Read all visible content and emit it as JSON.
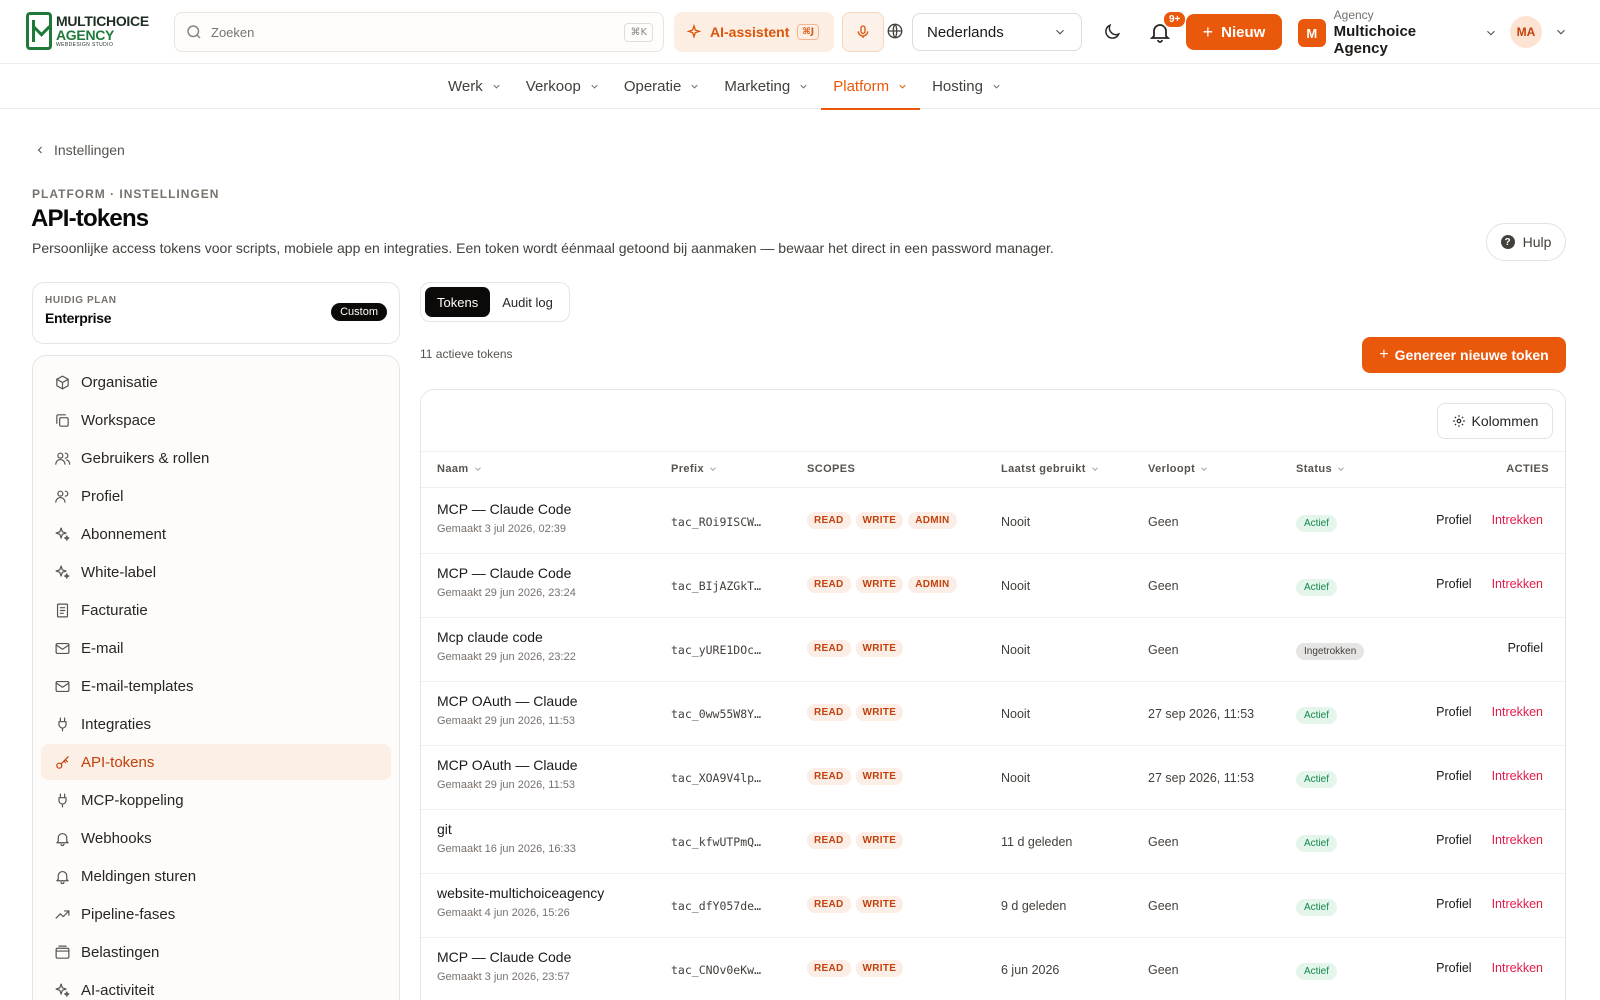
{
  "brand": {
    "line1": "MULTICHOICE",
    "line2": "AGENCY",
    "line3": "WEBDESIGN STUDIO"
  },
  "search": {
    "placeholder": "Zoeken",
    "shortcut": "⌘K"
  },
  "ai": {
    "label": "AI-assistent",
    "shortcut": "⌘J"
  },
  "language": {
    "selected": "Nederlands"
  },
  "notifications": {
    "count": "9+"
  },
  "new_button": "Nieuw",
  "agency": {
    "initial": "M",
    "label": "Agency",
    "name": "Multichoice Agency"
  },
  "user": {
    "initials": "MA"
  },
  "nav": [
    {
      "label": "Werk"
    },
    {
      "label": "Verkoop"
    },
    {
      "label": "Operatie"
    },
    {
      "label": "Marketing"
    },
    {
      "label": "Platform",
      "active": true
    },
    {
      "label": "Hosting"
    }
  ],
  "breadcrumb": "Instellingen",
  "eyebrow": "PLATFORM · INSTELLINGEN",
  "title": "API-tokens",
  "description": "Persoonlijke access tokens voor scripts, mobiele app en integraties. Een token wordt éénmaal getoond bij aanmaken — bewaar het direct in een password manager.",
  "help_label": "Hulp",
  "plan": {
    "label": "HUIDIG PLAN",
    "name": "Enterprise",
    "badge": "Custom"
  },
  "sidebar": [
    {
      "label": "Organisatie",
      "icon": "cube-icon"
    },
    {
      "label": "Workspace",
      "icon": "copy-icon"
    },
    {
      "label": "Gebruikers & rollen",
      "icon": "users-icon"
    },
    {
      "label": "Profiel",
      "icon": "user-icon"
    },
    {
      "label": "Abonnement",
      "icon": "sparkle-icon"
    },
    {
      "label": "White-label",
      "icon": "sparkle-icon"
    },
    {
      "label": "Facturatie",
      "icon": "receipt-icon"
    },
    {
      "label": "E-mail",
      "icon": "mail-icon"
    },
    {
      "label": "E-mail-templates",
      "icon": "mail-icon"
    },
    {
      "label": "Integraties",
      "icon": "plug-icon"
    },
    {
      "label": "API-tokens",
      "icon": "key-icon",
      "active": true
    },
    {
      "label": "MCP-koppeling",
      "icon": "plug-icon"
    },
    {
      "label": "Webhooks",
      "icon": "bell-icon"
    },
    {
      "label": "Meldingen sturen",
      "icon": "bell-icon"
    },
    {
      "label": "Pipeline-fases",
      "icon": "trend-icon"
    },
    {
      "label": "Belastingen",
      "icon": "wallet-icon"
    },
    {
      "label": "AI-activiteit",
      "icon": "sparkle-icon"
    }
  ],
  "tabs": [
    {
      "label": "Tokens",
      "active": true
    },
    {
      "label": "Audit log"
    }
  ],
  "count_label": "11 actieve tokens",
  "generate_label": "Genereer nieuwe token",
  "columns_label": "Kolommen",
  "columns": {
    "name": "Naam",
    "prefix": "Prefix",
    "scopes": "SCOPES",
    "last": "Laatst gebruikt",
    "expires": "Verloopt",
    "status": "Status",
    "actions": "ACTIES"
  },
  "tokens": [
    {
      "name": "MCP — Claude Code",
      "created": "Gemaakt 3 jul 2026, 02:39",
      "prefix": "tac_ROi9ISCW…",
      "scopes": [
        "READ",
        "WRITE",
        "ADMIN"
      ],
      "last": "Nooit",
      "expires": "Geen",
      "status": "Actief",
      "profile": "Profiel",
      "revoke": "Intrekken"
    },
    {
      "name": "MCP — Claude Code",
      "created": "Gemaakt 29 jun 2026, 23:24",
      "prefix": "tac_BIjAZGkT…",
      "scopes": [
        "READ",
        "WRITE",
        "ADMIN"
      ],
      "last": "Nooit",
      "expires": "Geen",
      "status": "Actief",
      "profile": "Profiel",
      "revoke": "Intrekken"
    },
    {
      "name": "Mcp claude code",
      "created": "Gemaakt 29 jun 2026, 23:22",
      "prefix": "tac_yURE1DOc…",
      "scopes": [
        "READ",
        "WRITE"
      ],
      "last": "Nooit",
      "expires": "Geen",
      "status": "Ingetrokken",
      "profile": "Profiel",
      "revoke": ""
    },
    {
      "name": "MCP OAuth — Claude",
      "created": "Gemaakt 29 jun 2026, 11:53",
      "prefix": "tac_0ww55W8Y…",
      "scopes": [
        "READ",
        "WRITE"
      ],
      "last": "Nooit",
      "expires": "27 sep 2026, 11:53",
      "status": "Actief",
      "profile": "Profiel",
      "revoke": "Intrekken"
    },
    {
      "name": "MCP OAuth — Claude",
      "created": "Gemaakt 29 jun 2026, 11:53",
      "prefix": "tac_XOA9V4lp…",
      "scopes": [
        "READ",
        "WRITE"
      ],
      "last": "Nooit",
      "expires": "27 sep 2026, 11:53",
      "status": "Actief",
      "profile": "Profiel",
      "revoke": "Intrekken"
    },
    {
      "name": "git",
      "created": "Gemaakt 16 jun 2026, 16:33",
      "prefix": "tac_kfwUTPmQ…",
      "scopes": [
        "READ",
        "WRITE"
      ],
      "last": "11 d geleden",
      "expires": "Geen",
      "status": "Actief",
      "profile": "Profiel",
      "revoke": "Intrekken"
    },
    {
      "name": "website-multichoiceagency",
      "created": "Gemaakt 4 jun 2026, 15:26",
      "prefix": "tac_dfY057de…",
      "scopes": [
        "READ",
        "WRITE"
      ],
      "last": "9 d geleden",
      "expires": "Geen",
      "status": "Actief",
      "profile": "Profiel",
      "revoke": "Intrekken"
    },
    {
      "name": "MCP — Claude Code",
      "created": "Gemaakt 3 jun 2026, 23:57",
      "prefix": "tac_CNOv0eKw…",
      "scopes": [
        "READ",
        "WRITE"
      ],
      "last": "6 jun 2026",
      "expires": "Geen",
      "status": "Actief",
      "profile": "Profiel",
      "revoke": "Intrekken"
    }
  ],
  "colors": {
    "accent": "#ea580c",
    "brand_green": "#1f7a3a",
    "danger": "#e11d48",
    "success": "#16884a"
  }
}
